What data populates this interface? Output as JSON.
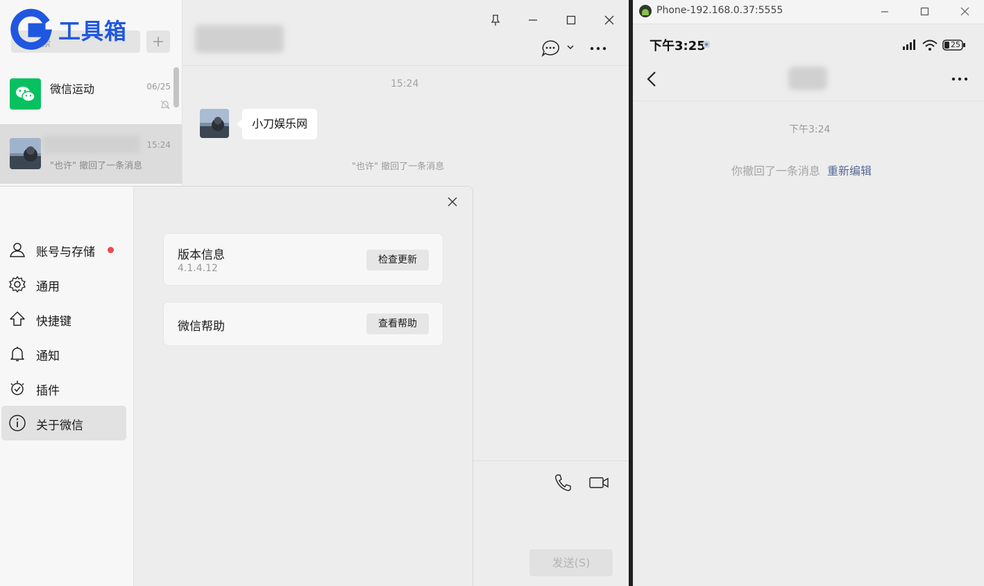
{
  "brand": {
    "logo_text": "工具箱",
    "accent": "#1f57e0"
  },
  "wechat": {
    "search": {
      "placeholder_visible": "索"
    },
    "chat_list": [
      {
        "name": "微信运动",
        "time": "06/25",
        "preview": "",
        "muted": true,
        "icon": "wechat-sport-icon"
      },
      {
        "name": "",
        "time": "15:24",
        "preview": "\"也许\" 撤回了一条消息",
        "muted": false,
        "icon": "avatar"
      }
    ],
    "chat": {
      "time_separator": "15:24",
      "messages": [
        {
          "text": "小刀娱乐网"
        }
      ],
      "recall_note": "\"也许\" 撤回了一条消息",
      "send_label": "发送(S)"
    },
    "settings": {
      "nav": [
        {
          "label": "账号与存储",
          "icon": "person-icon",
          "badge": true
        },
        {
          "label": "通用",
          "icon": "gear-icon",
          "badge": false
        },
        {
          "label": "快捷键",
          "icon": "shortcut-arrow-icon",
          "badge": false
        },
        {
          "label": "通知",
          "icon": "bell-icon",
          "badge": false
        },
        {
          "label": "插件",
          "icon": "plugin-icon",
          "badge": false
        },
        {
          "label": "关于微信",
          "icon": "info-icon",
          "badge": false,
          "active": true
        }
      ],
      "cards": [
        {
          "title": "版本信息",
          "subtitle": "4.1.4.12",
          "button": "检查更新"
        },
        {
          "title": "微信帮助",
          "subtitle": "",
          "button": "查看帮助"
        }
      ]
    }
  },
  "phone": {
    "window_title": "Phone-192.168.0.37:5555",
    "status_time": "下午3:25",
    "battery": "25",
    "chat_time": "下午3:24",
    "recall_text": "你撤回了一条消息",
    "reedit_label": "重新编辑"
  },
  "colors": {
    "red_badge": "#f04848",
    "wechat_green": "#07c160",
    "link_blue": "#576b95"
  }
}
